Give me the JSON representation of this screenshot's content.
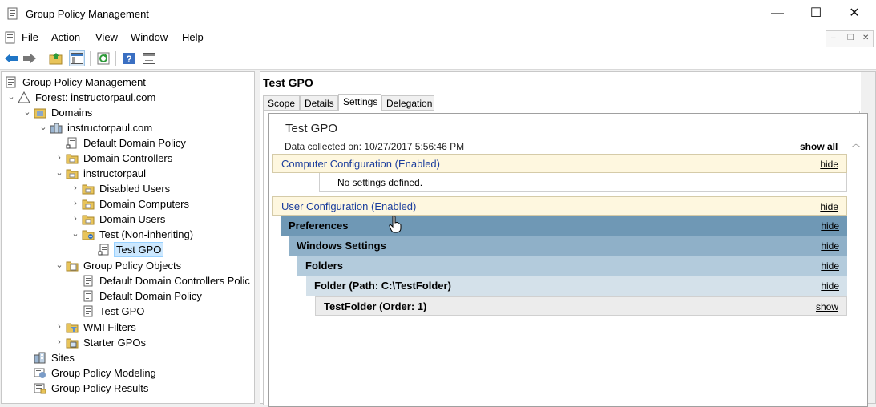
{
  "window": {
    "title": "Group Policy Management",
    "controls": {
      "minimize": "—",
      "maximize": "☐",
      "close": "✕"
    }
  },
  "menu": {
    "items": [
      "File",
      "Action",
      "View",
      "Window",
      "Help"
    ],
    "mdi_controls": [
      "–",
      "❐",
      "✕"
    ]
  },
  "toolbar": {
    "icons": [
      "back-arrow-icon",
      "forward-arrow-icon",
      "up-folder-icon",
      "show-hide-tree-icon",
      "refresh-icon",
      "help-icon",
      "properties-icon"
    ]
  },
  "tree": {
    "items": [
      {
        "label": "Group Policy Management",
        "expander": "",
        "icon": "gpm-console-icon"
      },
      {
        "label": "Forest: instructorpaul.com",
        "expander": "⌄",
        "icon": "forest-icon"
      },
      {
        "label": "Domains",
        "expander": "⌄",
        "icon": "domains-icon"
      },
      {
        "label": "instructorpaul.com",
        "expander": "⌄",
        "icon": "domain-icon"
      },
      {
        "label": "Default Domain Policy",
        "expander": "",
        "icon": "gpo-link-icon"
      },
      {
        "label": "Domain Controllers",
        "expander": "›",
        "icon": "ou-folder-icon"
      },
      {
        "label": "instructorpaul",
        "expander": "⌄",
        "icon": "ou-folder-icon"
      },
      {
        "label": "Disabled Users",
        "expander": "›",
        "icon": "ou-folder-icon"
      },
      {
        "label": "Domain Computers",
        "expander": "›",
        "icon": "ou-folder-icon"
      },
      {
        "label": "Domain Users",
        "expander": "›",
        "icon": "ou-folder-icon"
      },
      {
        "label": "Test (Non-inheriting)",
        "expander": "⌄",
        "icon": "ou-folder-blocked-icon"
      },
      {
        "label": "Test GPO",
        "expander": "",
        "icon": "gpo-link-icon",
        "selected": true
      },
      {
        "label": "Group Policy Objects",
        "expander": "⌄",
        "icon": "gpo-container-icon"
      },
      {
        "label": "Default Domain Controllers Polic",
        "expander": "",
        "icon": "gpo-icon"
      },
      {
        "label": "Default Domain Policy",
        "expander": "",
        "icon": "gpo-icon"
      },
      {
        "label": "Test GPO",
        "expander": "",
        "icon": "gpo-icon"
      },
      {
        "label": "WMI Filters",
        "expander": "›",
        "icon": "wmi-filter-folder-icon"
      },
      {
        "label": "Starter GPOs",
        "expander": "›",
        "icon": "starter-gpo-folder-icon"
      },
      {
        "label": "Sites",
        "expander": "",
        "icon": "sites-icon"
      },
      {
        "label": "Group Policy Modeling",
        "expander": "",
        "icon": "modeling-icon"
      },
      {
        "label": "Group Policy Results",
        "expander": "",
        "icon": "results-icon"
      }
    ]
  },
  "detail": {
    "heading": "Test GPO",
    "tabs": [
      "Scope",
      "Details",
      "Settings",
      "Delegation"
    ],
    "active_tab": "Settings",
    "report": {
      "title": "Test GPO",
      "date": "Data collected on: 10/27/2017 5:56:46 PM",
      "show_all": "show all",
      "computer_config": {
        "label": "Computer Configuration (Enabled)",
        "link": "hide",
        "note": "No settings defined."
      },
      "user_config": {
        "label": "User Configuration (Enabled)",
        "link": "hide"
      },
      "levels": [
        {
          "label": "Preferences",
          "link": "hide"
        },
        {
          "label": "Windows Settings",
          "link": "hide"
        },
        {
          "label": "Folders",
          "link": "hide"
        },
        {
          "label": "Folder (Path: C:\\TestFolder)",
          "link": "hide"
        },
        {
          "label": "TestFolder (Order: 1)",
          "link": "show"
        }
      ]
    }
  },
  "colors": {
    "config_bg": "#fef7df",
    "config_text": "#1c3e9d",
    "level_bgs": [
      "#6f98b5",
      "#8fb0c8",
      "#b3cbdc",
      "#d4e1ea",
      "#ececec"
    ]
  }
}
